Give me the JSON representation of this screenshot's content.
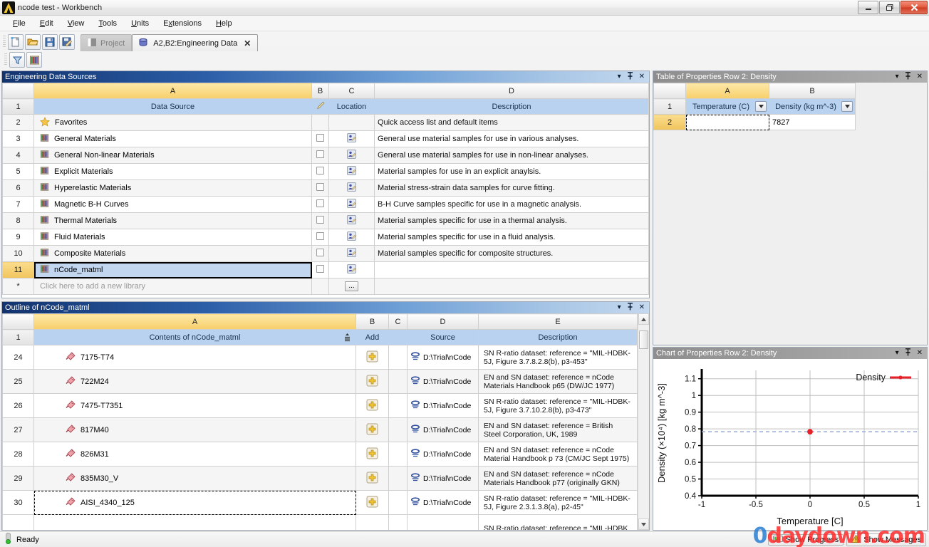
{
  "window": {
    "title": "ncode test - Workbench",
    "logo_icon": "workbench-logo-icon",
    "minimize_label": "Minimize",
    "restore_label": "Restore",
    "close_label": "Close"
  },
  "menu": {
    "items": [
      {
        "label": "File",
        "mnemonic": "F"
      },
      {
        "label": "Edit",
        "mnemonic": "E"
      },
      {
        "label": "View",
        "mnemonic": "V"
      },
      {
        "label": "Tools",
        "mnemonic": "T"
      },
      {
        "label": "Units",
        "mnemonic": "U"
      },
      {
        "label": "Extensions",
        "mnemonic": "x"
      },
      {
        "label": "Help",
        "mnemonic": "H"
      }
    ]
  },
  "toolbar": {
    "buttons": [
      {
        "icon": "new-file-icon",
        "label": "New"
      },
      {
        "icon": "open-folder-icon",
        "label": "Open"
      },
      {
        "icon": "save-icon",
        "label": "Save"
      },
      {
        "icon": "save-as-icon",
        "label": "Save As"
      }
    ],
    "buttons2": [
      {
        "icon": "filter-icon",
        "label": "Filter Engineering Data"
      },
      {
        "icon": "engineering-data-sources-icon",
        "label": "Engineering Data Sources"
      }
    ],
    "tabs": [
      {
        "label": "Project",
        "icon": "project-icon",
        "active": false,
        "closable": false
      },
      {
        "label": "A2,B2:Engineering Data",
        "icon": "engineering-data-icon",
        "active": true,
        "closable": true,
        "close_label": "✕"
      }
    ]
  },
  "data_sources_panel": {
    "title": "Engineering Data Sources",
    "controls": {
      "menu": "▾",
      "pin": "✕",
      "close": "✕"
    },
    "column_letters": [
      "A",
      "B",
      "C",
      "D"
    ],
    "headers": {
      "a": "Data Source",
      "b_icon": "pencil-icon",
      "c": "Location",
      "d": "Description"
    },
    "rows": [
      {
        "n": "2",
        "icon": "favorites-star-icon",
        "name": "Favorites",
        "check": false,
        "location": false,
        "desc": "Quick access list and default items",
        "selected": false
      },
      {
        "n": "3",
        "icon": "library-icon",
        "name": "General Materials",
        "check": true,
        "location": true,
        "desc": "General use material samples for use in various analyses.",
        "selected": false
      },
      {
        "n": "4",
        "icon": "library-icon",
        "name": "General Non-linear Materials",
        "check": true,
        "location": true,
        "desc": "General use material samples for use in non-linear analyses.",
        "selected": false
      },
      {
        "n": "5",
        "icon": "library-icon",
        "name": "Explicit Materials",
        "check": true,
        "location": true,
        "desc": "Material samples for use in an explicit anaylsis.",
        "selected": false
      },
      {
        "n": "6",
        "icon": "library-icon",
        "name": "Hyperelastic Materials",
        "check": true,
        "location": true,
        "desc": "Material stress-strain data samples for curve fitting.",
        "selected": false
      },
      {
        "n": "7",
        "icon": "library-icon",
        "name": "Magnetic B-H Curves",
        "check": true,
        "location": true,
        "desc": "B-H Curve samples specific for use in a magnetic analysis.",
        "selected": false
      },
      {
        "n": "8",
        "icon": "library-icon",
        "name": "Thermal Materials",
        "check": true,
        "location": true,
        "desc": "Material samples specific for use in a thermal analysis.",
        "selected": false
      },
      {
        "n": "9",
        "icon": "library-icon",
        "name": "Fluid Materials",
        "check": true,
        "location": true,
        "desc": "Material samples specific for use in a fluid analysis.",
        "selected": false
      },
      {
        "n": "10",
        "icon": "library-icon",
        "name": "Composite Materials",
        "check": true,
        "location": true,
        "desc": "Material samples specific for composite structures.",
        "selected": false
      },
      {
        "n": "11",
        "icon": "library-icon",
        "name": "nCode_matml",
        "check": true,
        "location": true,
        "desc": "",
        "selected": true
      }
    ],
    "new_row": {
      "n": "*",
      "placeholder": "Click here to add a new library",
      "ellipsis": "..."
    }
  },
  "outline_panel": {
    "title": "Outline of nCode_matml",
    "controls": {
      "menu": "▾",
      "pin": "✕",
      "close": "✕"
    },
    "column_letters": [
      "A",
      "B",
      "C",
      "D",
      "E"
    ],
    "headers": {
      "a": "Contents of nCode_matml",
      "a_icon": "sort-icon",
      "b": "Add",
      "c": "",
      "d": "Source",
      "e": "Description"
    },
    "rows": [
      {
        "n": "24",
        "icon": "material-tag-icon",
        "name": "7175-T74",
        "add_icon": "add-plus-icon",
        "source": "D:\\Trial\\nCode",
        "desc": "SN R-ratio dataset: reference = \"MIL-HDBK-5J, Figure 3.7.8.2.8(b), p3-453\"",
        "selected": false
      },
      {
        "n": "25",
        "icon": "material-tag-icon",
        "name": "722M24",
        "add_icon": "add-plus-icon",
        "source": "D:\\Trial\\nCode",
        "desc": "EN and SN dataset: reference = nCode Materials Handbook p65 (DW/JC 1977)",
        "selected": false
      },
      {
        "n": "26",
        "icon": "material-tag-icon",
        "name": "7475-T7351",
        "add_icon": "add-plus-icon",
        "source": "D:\\Trial\\nCode",
        "desc": "SN R-ratio dataset: reference = \"MIL-HDBK-5J, Figure 3.7.10.2.8(b), p3-473\"",
        "selected": false
      },
      {
        "n": "27",
        "icon": "material-tag-icon",
        "name": "817M40",
        "add_icon": "add-plus-icon",
        "source": "D:\\Trial\\nCode",
        "desc": "EN and SN dataset: reference = British Steel Corporation, UK, 1989",
        "selected": false
      },
      {
        "n": "28",
        "icon": "material-tag-icon",
        "name": "826M31",
        "add_icon": "add-plus-icon",
        "source": "D:\\Trial\\nCode",
        "desc": "EN and SN dataset: reference = nCode Material Handbook p 73 (CM/JC Sept 1975)",
        "selected": false
      },
      {
        "n": "29",
        "icon": "material-tag-icon",
        "name": "835M30_V",
        "add_icon": "add-plus-icon",
        "source": "D:\\Trial\\nCode",
        "desc": "EN and SN dataset: reference = nCode Materials Handbook p77 (originally GKN)",
        "selected": false
      },
      {
        "n": "30",
        "icon": "material-tag-icon",
        "name": "AISI_4340_125",
        "add_icon": "add-plus-icon",
        "source": "D:\\Trial\\nCode",
        "desc": "SN R-ratio dataset: reference = \"MIL-HDBK-5J, Figure 2.3.1.3.8(a), p2-45\"",
        "selected": true
      }
    ],
    "partial_row_desc": "SN R-ratio dataset: reference =   \"MIL-HDBK"
  },
  "properties_panel": {
    "title": "Table of Properties Row 2: Density",
    "controls": {
      "menu": "▾",
      "pin": "✕",
      "close": "✕"
    },
    "column_letters": [
      "A",
      "B"
    ],
    "header_row": {
      "n": "1",
      "a": "Temperature (C)",
      "b": "Density (kg m^-3)",
      "dropdown": "▾"
    },
    "data_row": {
      "n": "2",
      "a": "",
      "b": "7827"
    }
  },
  "chart_panel": {
    "title": "Chart of Properties Row 2: Density",
    "controls": {
      "menu": "▾",
      "pin": "✕",
      "close": "✕"
    }
  },
  "chart_data": {
    "type": "scatter",
    "title": "",
    "xlabel": "Temperature [C]",
    "ylabel": "Density  (×10⁴)  [kg m^-3]",
    "ylabel_main": "Density",
    "ylabel_scale": "(x10⁴)",
    "ylabel_units": "[kg m^-3]",
    "xlim": [
      -1,
      1
    ],
    "ylim": [
      0.4,
      1.15
    ],
    "xticks": [
      -1,
      -0.5,
      0,
      0.5,
      1
    ],
    "xticklabels": [
      "-1",
      "-0.5",
      "0",
      "0.5",
      "1"
    ],
    "yticks": [
      0.4,
      0.5,
      0.6,
      0.7,
      0.8,
      0.9,
      1.0,
      1.1
    ],
    "yticklabels": [
      "0.4",
      "0.5",
      "0.6",
      "0.7",
      "0.8",
      "0.9",
      "1",
      "1.1"
    ],
    "grid": true,
    "legend": {
      "position": "top-right",
      "entries": [
        {
          "name": "Density",
          "color": "#e8202a",
          "marker": "circle"
        }
      ]
    },
    "series": [
      {
        "name": "Density",
        "color": "#e8202a",
        "points": [
          {
            "x": 0,
            "y": 0.7827
          }
        ],
        "guideline": {
          "y": 0.7827,
          "style": "dashed",
          "color": "#9fb0d8"
        }
      }
    ]
  },
  "statusbar": {
    "status_icon": "traffic-light-icon",
    "status_text": "Ready",
    "buttons": [
      {
        "label": "Show Progress",
        "icon": "progress-icon"
      },
      {
        "label": "Show Messages",
        "icon": "messages-icon"
      }
    ],
    "watermark": {
      "pre": "0",
      "blue": "0",
      "text": "daydown.com"
    }
  }
}
